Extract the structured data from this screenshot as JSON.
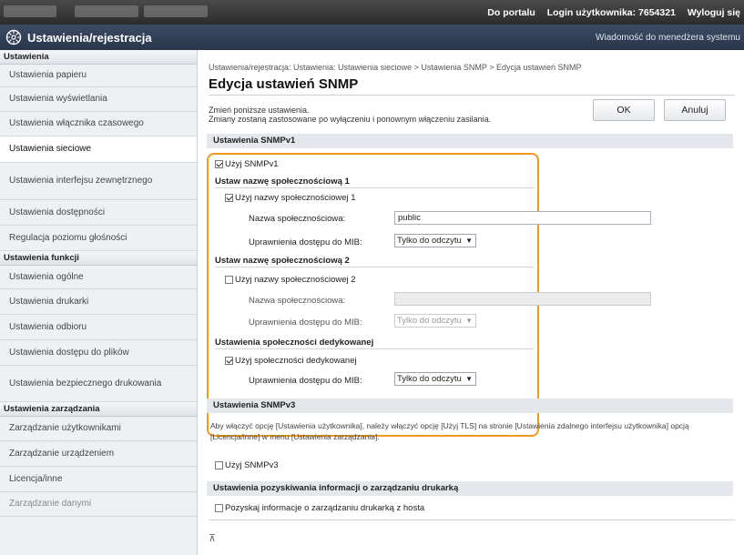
{
  "topbar": {
    "portal_label": "Do portalu",
    "login_label": "Login użytkownika:  7654321",
    "logout_label": "Wyloguj się"
  },
  "titlebar": {
    "title": "Ustawienia/rejestracja",
    "message": "Wiadomość do menedżera systemu"
  },
  "sidebar": {
    "section1": "Ustawienia",
    "items1": [
      {
        "label": "Ustawienia papieru"
      },
      {
        "label": "Ustawienia wyświetlania"
      },
      {
        "label": "Ustawienia włącznika czasowego"
      },
      {
        "label": "Ustawienia sieciowe"
      },
      {
        "label": "Ustawienia interfejsu zewnętrznego"
      },
      {
        "label": "Ustawienia dostępności"
      },
      {
        "label": "Regulacja poziomu głośności"
      }
    ],
    "section2": "Ustawienia funkcji",
    "items2": [
      {
        "label": "Ustawienia ogólne"
      },
      {
        "label": "Ustawienia drukarki"
      },
      {
        "label": "Ustawienia odbioru"
      },
      {
        "label": "Ustawienia dostępu do plików"
      },
      {
        "label": "Ustawienia bezpiecznego drukowania"
      }
    ],
    "section3": "Ustawienia zarządzania",
    "items3": [
      {
        "label": "Zarządzanie użytkownikami"
      },
      {
        "label": "Zarządzanie urządzeniem"
      },
      {
        "label": "Licencja/inne"
      },
      {
        "label": "Zarządzanie danymi"
      }
    ]
  },
  "main": {
    "breadcrumb": "Ustawienia/rejestracja: Ustawienia: Ustawienia sieciowe > Ustawienia SNMP > Edycja ustawień SNMP",
    "page_title": "Edycja ustawień SNMP",
    "intro_line1": "Zmień poniższe ustawienia.",
    "intro_line2": "Zmiany zostaną zastosowane po wyłączeniu i ponownym włączeniu zasilania.",
    "ok_label": "OK",
    "cancel_label": "Anuluj",
    "snmpv1": {
      "header": "Ustawienia SNMPv1",
      "use_snmpv1": "Użyj SNMPv1",
      "community1_header": "Ustaw nazwę społecznościową 1",
      "use_community1": "Użyj nazwy społecznościowej 1",
      "community_name_label": "Nazwa społecznościowa:",
      "community1_value": "public",
      "mib_access_label": "Uprawnienia dostępu do MIB:",
      "mib_option": "Tylko do odczytu",
      "community2_header": "Ustaw nazwę społecznościową 2",
      "use_community2": "Użyj nazwy społecznościowej 2",
      "community2_value": "",
      "dedicated_header": "Ustawienia społeczności dedykowanej",
      "use_dedicated": "Użyj społeczności dedykowanej"
    },
    "snmpv3": {
      "header": "Ustawienia SNMPv3",
      "note": "Aby włączyć opcję [Ustawienia użytkownika], należy włączyć opcję [Użyj TLS] na stronie [Ustawienia zdalnego interfejsu użytkownika] opcją [Licencja/inne] w menu [Ustawienia zarządzania].",
      "use_snmpv3": "Użyj SNMPv3"
    },
    "printer_info": {
      "header": "Ustawienia pozyskiwania informacji o zarządzaniu drukarką",
      "option": "Pozyskaj informacje o zarządzaniu drukarką z hosta"
    },
    "scroll_top_glyph": "⊼"
  }
}
